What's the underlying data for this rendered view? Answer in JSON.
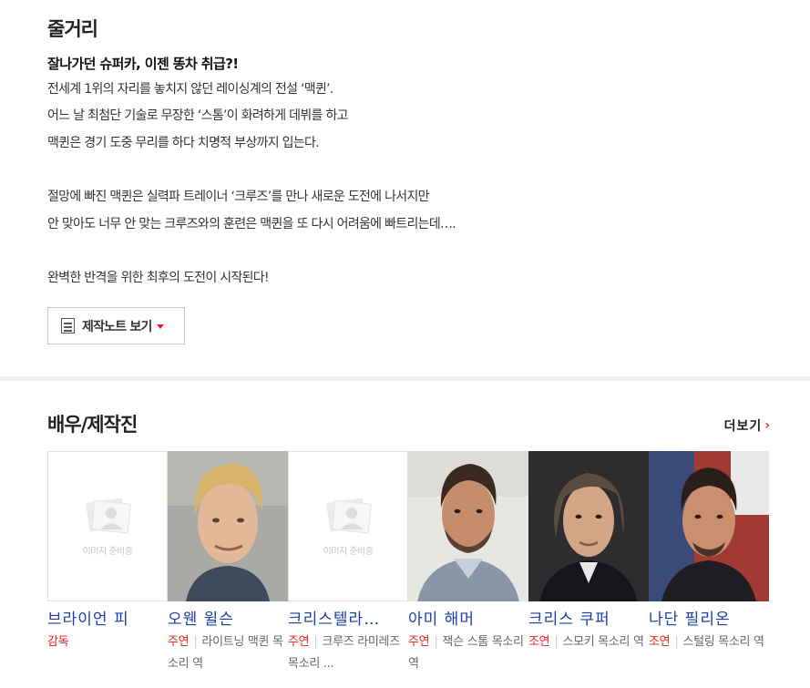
{
  "synopsis": {
    "title": "줄거리",
    "headline": "잘나가던 슈퍼카, 이젠 똥차 취급?!",
    "lines": [
      "전세계 1위의 자리를 놓치지 않던 레이싱계의 전설 ‘맥퀸’.",
      " 어느 날 최첨단 기술로 무장한 ‘스톰’이 화려하게 데뷔를 하고",
      " 맥퀸은 경기 도중 무리를 하다 치명적 부상까지 입는다.",
      "",
      " 절망에 빠진 맥퀸은 실력파 트레이너 ‘크루즈’를 만나 새로운 도전에 나서지만",
      " 안 맞아도 너무 안 맞는 크루즈와의 훈련은 맥퀸을 또 다시 어려움에 빠트리는데….",
      "",
      " 완벽한 반격을 위한 최후의 도전이 시작된다!"
    ],
    "note_button_label": "제작노트 보기"
  },
  "cast": {
    "title": "배우/제작진",
    "more_label": "더보기",
    "placeholder_text": "이미지 준비중",
    "members": [
      {
        "name": "브라이언 피",
        "role_type": "감독",
        "role_desc": ""
      },
      {
        "name": "오웬 윌슨",
        "role_type": "주연",
        "role_desc": "라이트닝 맥퀸 목소리 역"
      },
      {
        "name": "크리스텔라…",
        "role_type": "주연",
        "role_desc": "크루즈 라미레즈 목소리 ..."
      },
      {
        "name": "아미 해머",
        "role_type": "주연",
        "role_desc": "잭슨 스톰 목소리 역"
      },
      {
        "name": "크리스 쿠퍼",
        "role_type": "조연",
        "role_desc": "스모키 목소리 역"
      },
      {
        "name": "나단 필리온",
        "role_type": "조연",
        "role_desc": "스털링 목소리 역"
      }
    ]
  },
  "colors": {
    "accent_red": "#e8201d",
    "link_blue": "#1a3fa8"
  }
}
